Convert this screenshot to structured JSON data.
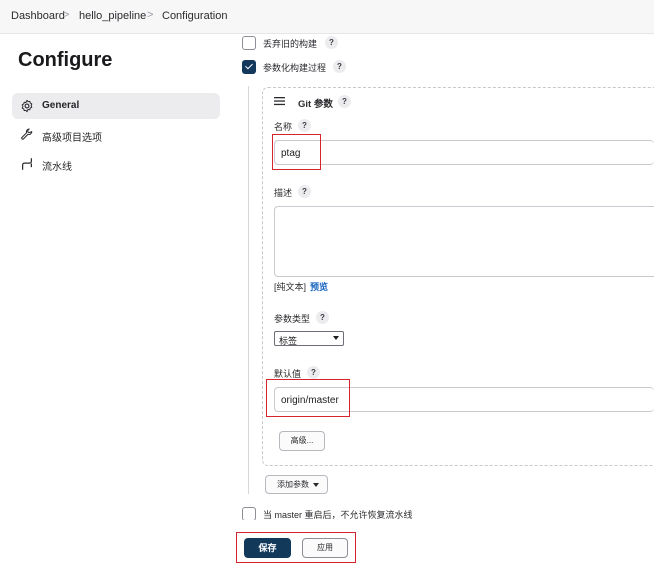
{
  "breadcrumb": {
    "items": [
      "Dashboard",
      "hello_pipeline",
      "Configuration"
    ],
    "separator": ">"
  },
  "sidebar": {
    "title": "Configure",
    "items": [
      {
        "label": "General",
        "icon": "gear-icon",
        "active": true
      },
      {
        "label": "高级项目选项",
        "icon": "wrench-icon",
        "active": false
      },
      {
        "label": "流水线",
        "icon": "pipeline-icon",
        "active": false
      }
    ]
  },
  "options": {
    "discard_builds": {
      "label": "丢弃旧的构建",
      "checked": false
    },
    "parameterized": {
      "label": "参数化构建过程",
      "checked": true
    },
    "no_resume": {
      "label": "当 master 重启后，不允许恢复流水线",
      "checked": false
    }
  },
  "help_label": "?",
  "git_param": {
    "header": "Git 参数",
    "name_label": "名称",
    "name_value": "ptag",
    "desc_label": "描述",
    "desc_value": "",
    "plain_text": "[纯文本]",
    "preview_link": "预览",
    "type_label": "参数类型",
    "type_value": "标签",
    "default_label": "默认值",
    "default_value": "origin/master",
    "advanced_button": "高级..."
  },
  "add_param_button": "添加参数",
  "footer": {
    "save": "保存",
    "apply": "应用"
  },
  "colors": {
    "primary": "#12385a",
    "highlight": "#d6242d",
    "link": "#1664c0"
  }
}
